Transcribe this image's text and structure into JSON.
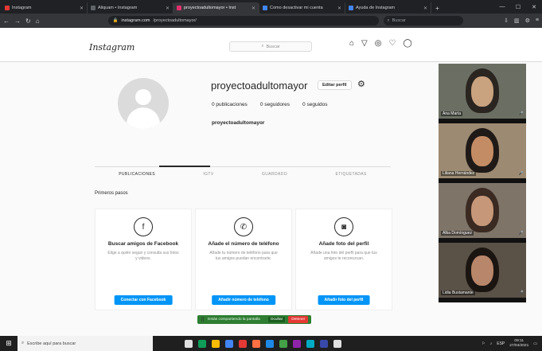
{
  "browser": {
    "tabs": [
      {
        "title": "Instagram",
        "color": "#e53935",
        "active": false
      },
      {
        "title": "Aliquam • Instagram",
        "color": "#5f6368",
        "active": false
      },
      {
        "title": "proyectoadultomayor • Inst",
        "color": "#e1306c",
        "active": true
      },
      {
        "title": "Como desactivar mi cuenta",
        "color": "#4285f4",
        "active": false
      },
      {
        "title": "Ayuda de Instagram",
        "color": "#4285f4",
        "active": false
      }
    ],
    "new_tab": "+",
    "url_host": "instagram.com",
    "url_path": "/proyectoadultomayor/",
    "search_placeholder": "Buscar",
    "window_controls": [
      "—",
      "☐",
      "✕"
    ]
  },
  "instagram": {
    "logo": "Instagram",
    "search_placeholder": "Buscar",
    "profile": {
      "username": "proyectoadultomayor",
      "edit_label": "Editar perfil",
      "posts": "0 publicaciones",
      "followers": "0 seguidores",
      "following": "0 seguidos",
      "full_name": "proyectoadultomayor"
    },
    "tabs": [
      "PUBLICACIONES",
      "IGTV",
      "GUARDADO",
      "ETIQUETADAS"
    ],
    "section_title": "Primeros pasos",
    "cards": [
      {
        "title": "Buscar amigos de Facebook",
        "desc": "Elige a quién seguir y consulta sus fotos y videos.",
        "button": "Conectar con Facebook",
        "icon": "f"
      },
      {
        "title": "Añade el número de teléfono",
        "desc": "Añade tu número de teléfono para que tus amigos puedan encontrarte.",
        "button": "Añadir número de teléfono",
        "icon": "✆"
      },
      {
        "title": "Añade foto del perfil",
        "desc": "Añade una foto del perfil para que tus amigos te reconozcan.",
        "button": "Añadir foto del perfil",
        "icon": "◙"
      }
    ]
  },
  "video_call": {
    "participants": [
      {
        "name": "Ana María",
        "bg": "#6b6f63",
        "face": "#c9a27f",
        "hair": "#2a2520"
      },
      {
        "name": "Liliana Hernández",
        "bg": "#9c8a72",
        "face": "#c48c65",
        "hair": "#1f1a17"
      },
      {
        "name": "Alba Domínguez",
        "bg": "#7e7468",
        "face": "#c79779",
        "hair": "#3a2a22"
      },
      {
        "name": "Lidia Bustamante",
        "bg": "#5a5147",
        "face": "#b8866a",
        "hair": "#1b1512"
      }
    ]
  },
  "share_bar": {
    "text": "Estás compartiendo la pantalla",
    "hide_label": "Ocultar",
    "stop_label": "Detener"
  },
  "taskbar": {
    "search_placeholder": "Escribe aquí para buscar",
    "app_colors": [
      "#e0e0e0",
      "#0f9d58",
      "#fbbc04",
      "#4285f4",
      "#e53935",
      "#ff7043",
      "#1e88e5",
      "#43a047",
      "#8e24aa",
      "#00acc1",
      "#3949ab",
      "#e0e0e0"
    ],
    "time": "09:11",
    "date": "27/04/2021",
    "lang": "ESP"
  }
}
